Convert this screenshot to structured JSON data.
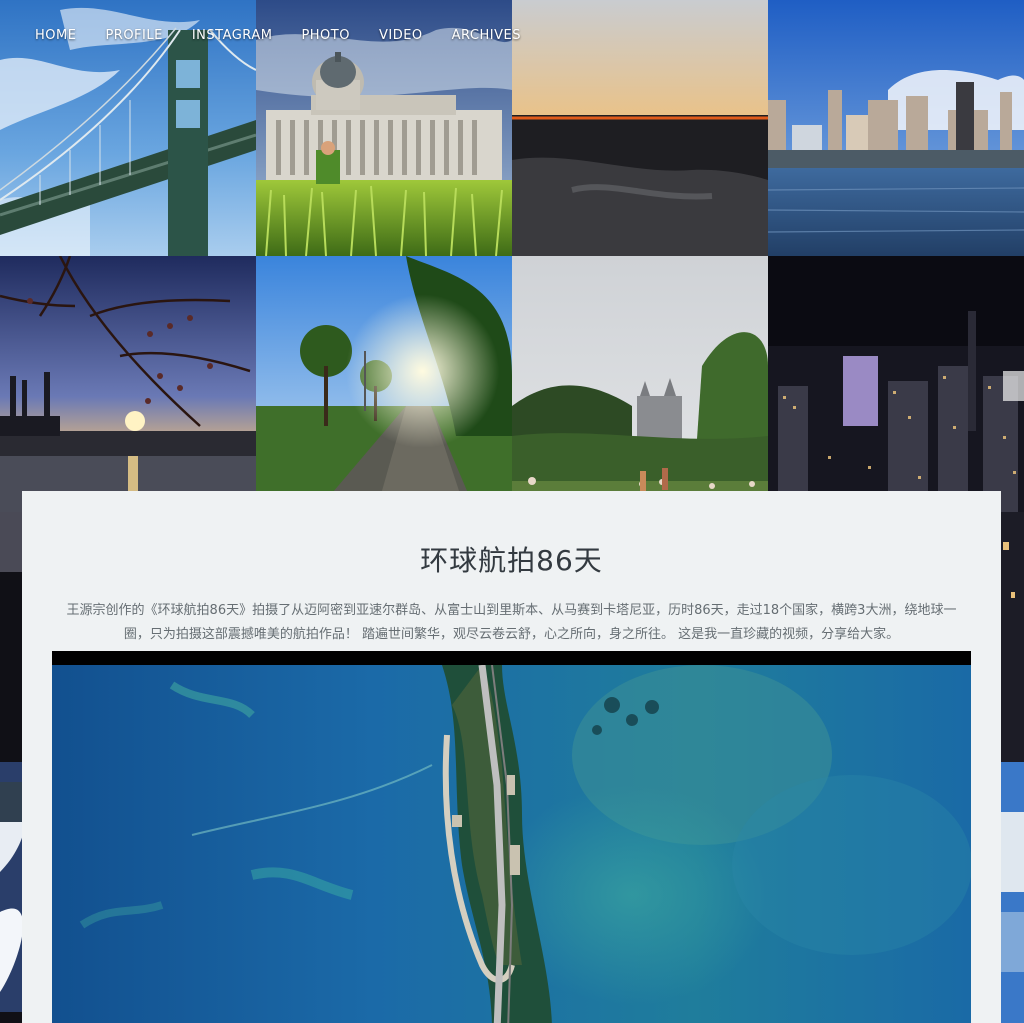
{
  "nav": {
    "items": [
      {
        "label": "HOME"
      },
      {
        "label": "PROFILE"
      },
      {
        "label": "INSTAGRAM"
      },
      {
        "label": "PHOTO"
      },
      {
        "label": "VIDEO"
      },
      {
        "label": "ARCHIVES"
      }
    ]
  },
  "mosaic": {
    "tiles": [
      {
        "subject": "suspension bridge under blue sky"
      },
      {
        "subject": "capitol building with photographer in grass"
      },
      {
        "subject": "orange sunset over river"
      },
      {
        "subject": "city skyline across water"
      },
      {
        "subject": "tree branches silhouetted at sunset"
      },
      {
        "subject": "sunlit park pathway with trees"
      },
      {
        "subject": "park with castle and people on lawn"
      },
      {
        "subject": "city at night"
      }
    ]
  },
  "post": {
    "title": "环球航拍86天",
    "description": "王源宗创作的《环球航拍86天》拍摄了从迈阿密到亚速尔群岛、从富士山到里斯本、从马赛到卡塔尼亚，历时86天，走过18个国家，横跨3大洲，绕地球一圈，只为拍摄这部震撼唯美的航拍作品！ 踏遍世间繁华，观尽云卷云舒，心之所向，身之所往。 这是我一直珍藏的视频，分享给大家。",
    "video": {
      "subject": "aerial view of island road over turquoise sea"
    }
  },
  "colors": {
    "panel_bg": "#eff2f3",
    "title_text": "#333a40",
    "body_text": "#666e73",
    "nav_text": "#ffffff"
  }
}
